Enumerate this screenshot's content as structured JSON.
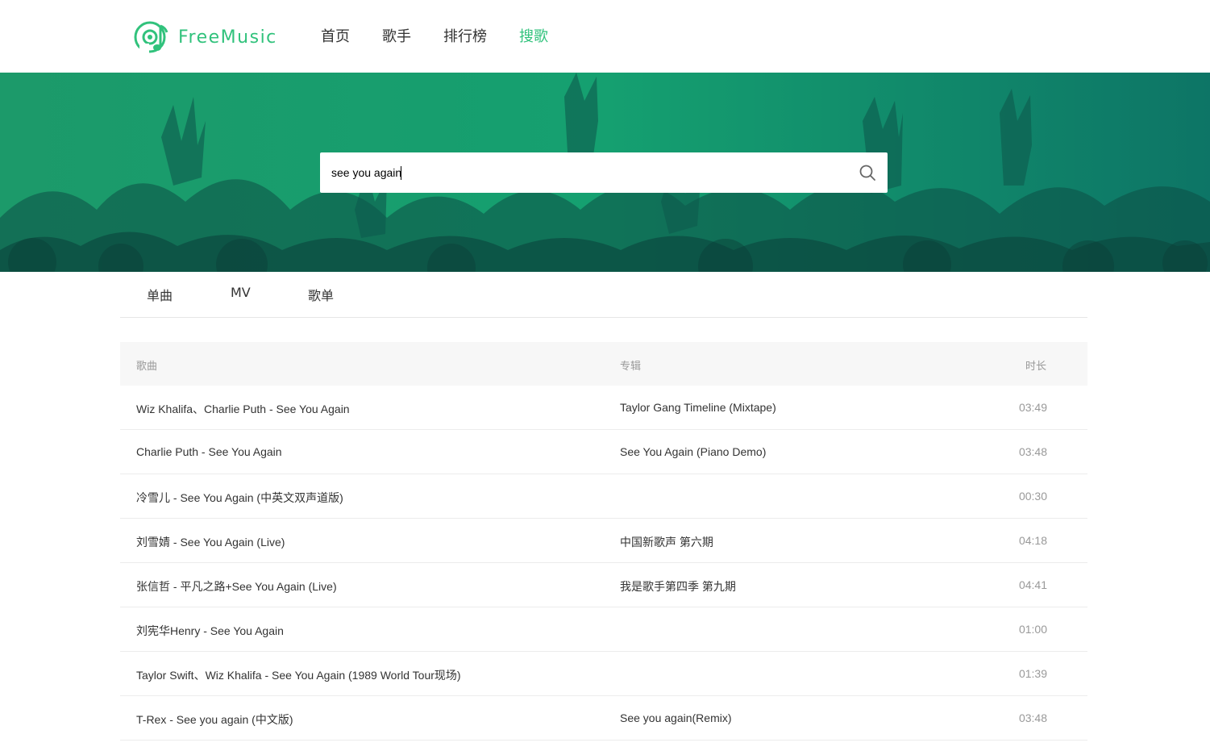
{
  "header": {
    "logo_text": "FreeMusic",
    "nav": [
      {
        "label": "首页",
        "active": false
      },
      {
        "label": "歌手",
        "active": false
      },
      {
        "label": "排行榜",
        "active": false
      },
      {
        "label": "搜歌",
        "active": true
      }
    ]
  },
  "search": {
    "value": "see you again",
    "icon": "search-icon"
  },
  "tabs": [
    "单曲",
    "MV",
    "歌单"
  ],
  "table": {
    "headers": {
      "song": "歌曲",
      "album": "专辑",
      "duration": "时长"
    },
    "rows": [
      {
        "title": "Wiz Khalifa、Charlie Puth - See You Again",
        "album": "Taylor Gang Timeline (Mixtape)",
        "duration": "03:49"
      },
      {
        "title": "Charlie Puth - See You Again",
        "album": "See You Again (Piano Demo)",
        "duration": "03:48"
      },
      {
        "title": "冷雪儿 - See You Again (中英文双声道版)",
        "album": "",
        "duration": "00:30"
      },
      {
        "title": "刘雪婧 - See You Again (Live)",
        "album": "中国新歌声 第六期",
        "duration": "04:18"
      },
      {
        "title": "张信哲 - 平凡之路+See You Again (Live)",
        "album": "我是歌手第四季 第九期",
        "duration": "04:41"
      },
      {
        "title": "刘宪华Henry - See You Again",
        "album": "",
        "duration": "01:00"
      },
      {
        "title": "Taylor Swift、Wiz Khalifa - See You Again (1989 World Tour现场)",
        "album": "",
        "duration": "01:39"
      },
      {
        "title": "T-Rex - See you again (中文版)",
        "album": "See you again(Remix)",
        "duration": "03:48"
      }
    ]
  },
  "colors": {
    "accent": "#31c27c",
    "banner": "#138a66"
  }
}
